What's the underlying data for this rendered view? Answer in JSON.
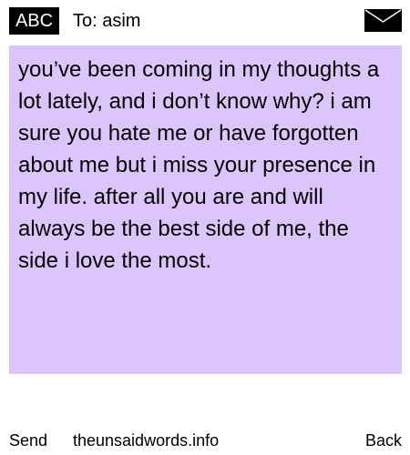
{
  "header": {
    "input_mode": "ABC",
    "to_label": "To: asim",
    "icon": "envelope-icon"
  },
  "message": {
    "text": "you’ve been coming in my thoughts a lot lately, and i don’t know why? i am sure you hate me or have forgotten about me but i miss your presence in my life. after all you are and will always be the best side of me, the side i love the most.",
    "background_color": "#dcc5fb"
  },
  "footer": {
    "send_label": "Send",
    "site_label": "theunsaidwords.info",
    "back_label": "Back"
  }
}
